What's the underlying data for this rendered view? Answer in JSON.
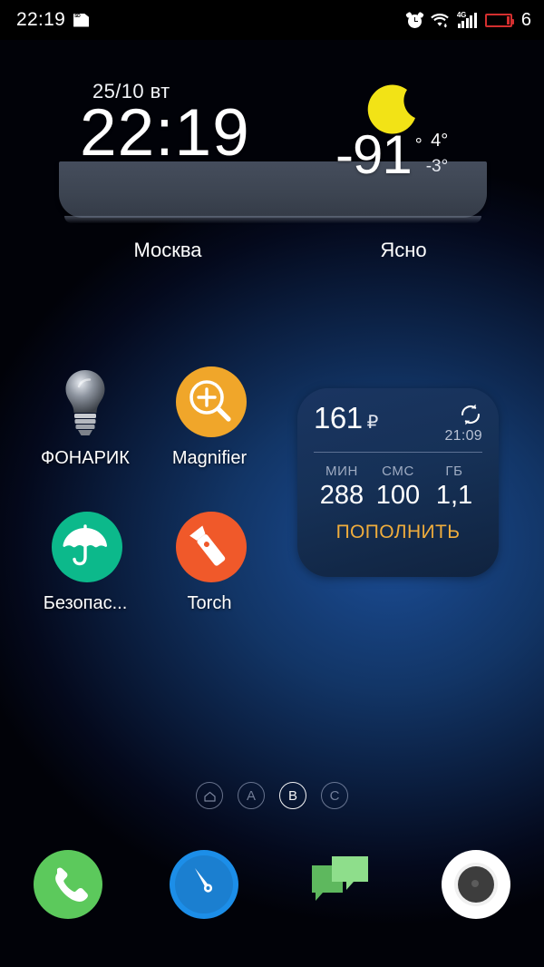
{
  "status_bar": {
    "time": "22:19",
    "sd_label": "SD",
    "sd_icon": "sd-card-icon",
    "alarm_icon": "alarm-clock-icon",
    "wifi_icon": "wifi-icon",
    "network_type": "4G",
    "signal_icon": "signal-bars-icon",
    "battery_icon": "battery-low-icon",
    "battery_percent": "6",
    "battery_color": "#d32f2f"
  },
  "clock_widget": {
    "date": "25/10 вт",
    "time": "22:19",
    "city": "Москва",
    "condition": "Ясно",
    "weather_icon": "crescent-moon-icon",
    "weather_icon_color": "#f2e316",
    "temp_current": "-91",
    "temp_degree_symbol": "°",
    "temp_high": "4°",
    "temp_low": "-3°"
  },
  "apps": [
    {
      "label": "ФОНАРИК",
      "icon": "light-bulb-icon",
      "bg": "transparent",
      "fg": "#cfd4dc"
    },
    {
      "label": "Magnifier",
      "icon": "magnifier-plus-icon",
      "bg": "#f0a62a",
      "fg": "#ffffff"
    },
    {
      "label": "Безопас...",
      "icon": "umbrella-icon",
      "bg": "#0cb98b",
      "fg": "#ffffff"
    },
    {
      "label": "Torch",
      "icon": "flashlight-icon",
      "bg": "#f0592a",
      "fg": "#ffffff"
    }
  ],
  "balance_widget": {
    "amount": "161",
    "currency": "₽",
    "refresh_icon": "refresh-icon",
    "updated_time": "21:09",
    "stats": [
      {
        "label": "МИН",
        "value": "288"
      },
      {
        "label": "СМС",
        "value": "100"
      },
      {
        "label": "ГБ",
        "value": "1,1"
      }
    ],
    "action_label": "ПОПОЛНИТЬ",
    "action_color": "#f0ad3c"
  },
  "page_indicators": {
    "items": [
      {
        "label": "",
        "icon": "home-icon",
        "active": false
      },
      {
        "label": "A",
        "icon": "",
        "active": false
      },
      {
        "label": "B",
        "icon": "",
        "active": true
      },
      {
        "label": "C",
        "icon": "",
        "active": false
      }
    ]
  },
  "dock": [
    {
      "name": "phone",
      "icon": "phone-icon",
      "bg": "#5cc95c"
    },
    {
      "name": "browser",
      "icon": "compass-icon",
      "bg": "#1c8ee8"
    },
    {
      "name": "messages",
      "icon": "messages-icon",
      "bg": "#72c472"
    },
    {
      "name": "camera",
      "icon": "camera-icon",
      "bg": "#ffffff"
    }
  ]
}
